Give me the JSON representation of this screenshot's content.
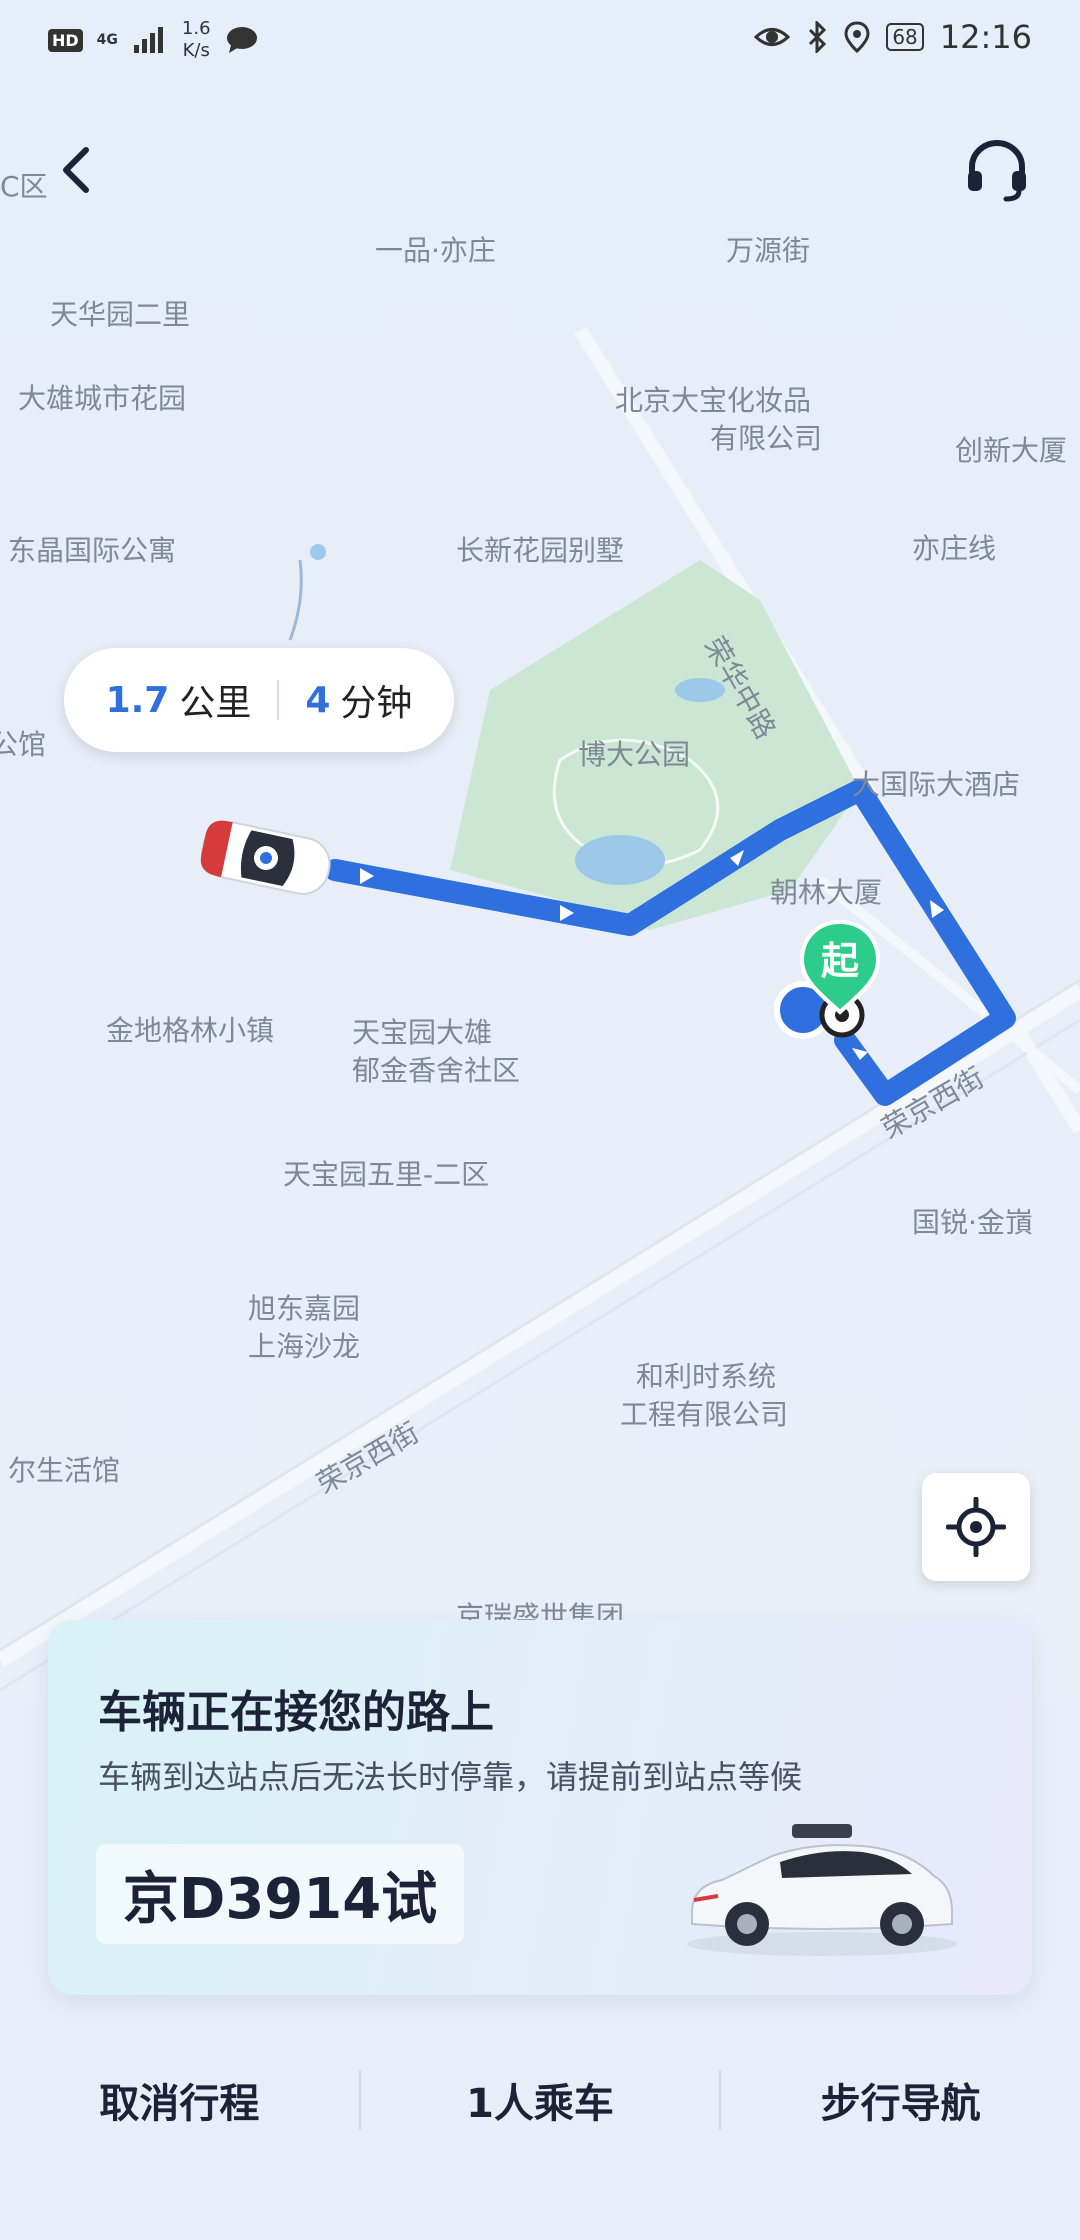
{
  "status_bar": {
    "hd": "HD",
    "network": "4G",
    "speed_value": "1.6",
    "speed_unit": "K/s",
    "battery": "68",
    "time": "12:16"
  },
  "map": {
    "labels": [
      "一品·亦庄",
      "万源街",
      "天华园二里",
      "大雄城市花园",
      "北京大宝化妆品",
      "有限公司",
      "创新大厦",
      "东晶国际公寓",
      "长新花园别墅",
      "亦庄线",
      "荣华中路",
      "博大公园",
      "大国际大酒店",
      "朝林大厦",
      "金地格林小镇",
      "天宝园大雄",
      "郁金香舍社区",
      "荣京西街",
      "天宝园五里-二区",
      "国锐·金嵿",
      "旭东嘉园",
      "上海沙龙",
      "和利时系统",
      "工程有限公司",
      "荣京西街",
      "尔生活馆",
      "公馆",
      "京瑞盛世集团",
      "C区"
    ],
    "start_marker": "起"
  },
  "distance": {
    "km_value": "1.7",
    "km_unit": "公里",
    "min_value": "4",
    "min_unit": "分钟"
  },
  "card": {
    "title": "车辆正在接您的路上",
    "subtitle": "车辆到达站点后无法长时停靠，请提前到站点等候",
    "plate": "京D3914试"
  },
  "actions": {
    "cancel": "取消行程",
    "passengers": "1人乘车",
    "walk_nav": "步行导航"
  },
  "colors": {
    "route": "#2f6fde",
    "start_marker": "#2ecc8a",
    "park": "#c8e6cf"
  }
}
